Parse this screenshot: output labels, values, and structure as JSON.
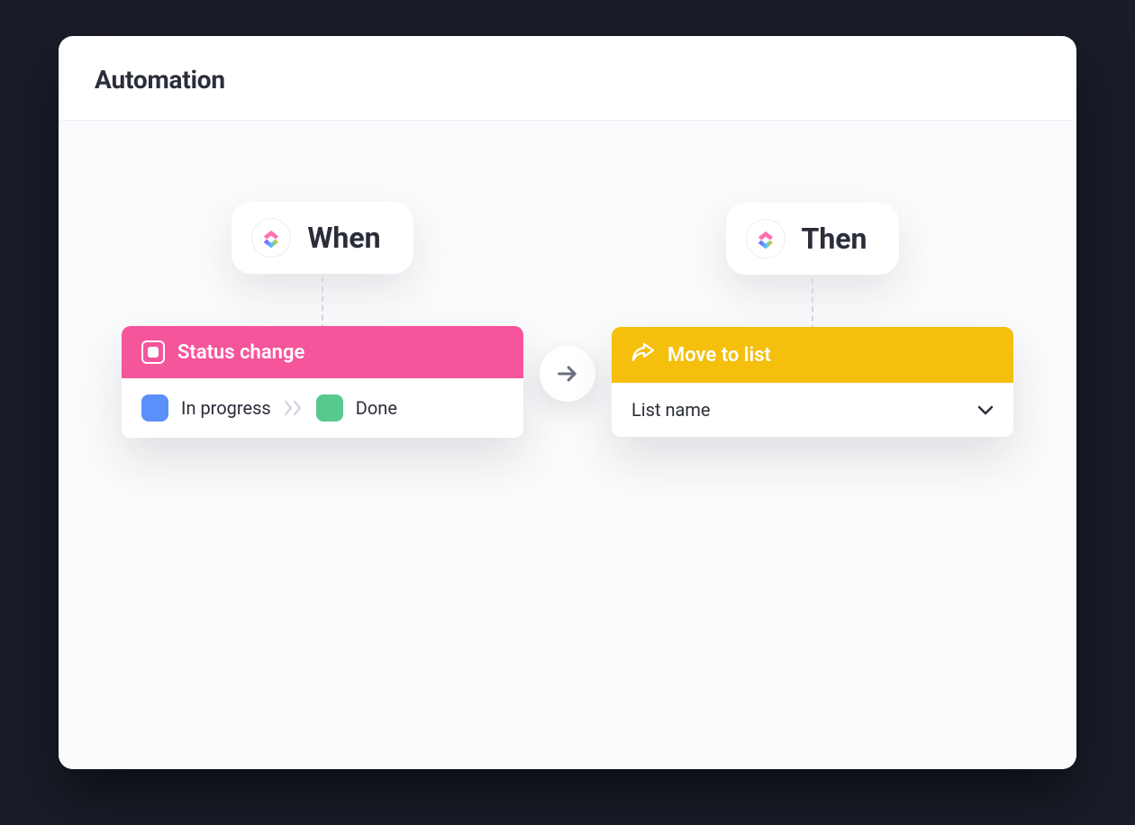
{
  "header": {
    "title": "Automation"
  },
  "when": {
    "pill_label": "When",
    "card_title": "Status change",
    "from_status": "In progress",
    "to_status": "Done",
    "from_color": "#5b8ff9",
    "to_color": "#58c98d"
  },
  "then": {
    "pill_label": "Then",
    "card_title": "Move to list",
    "select_placeholder": "List name"
  },
  "colors": {
    "pink": "#f5559b",
    "yellow": "#f4bf0d"
  }
}
